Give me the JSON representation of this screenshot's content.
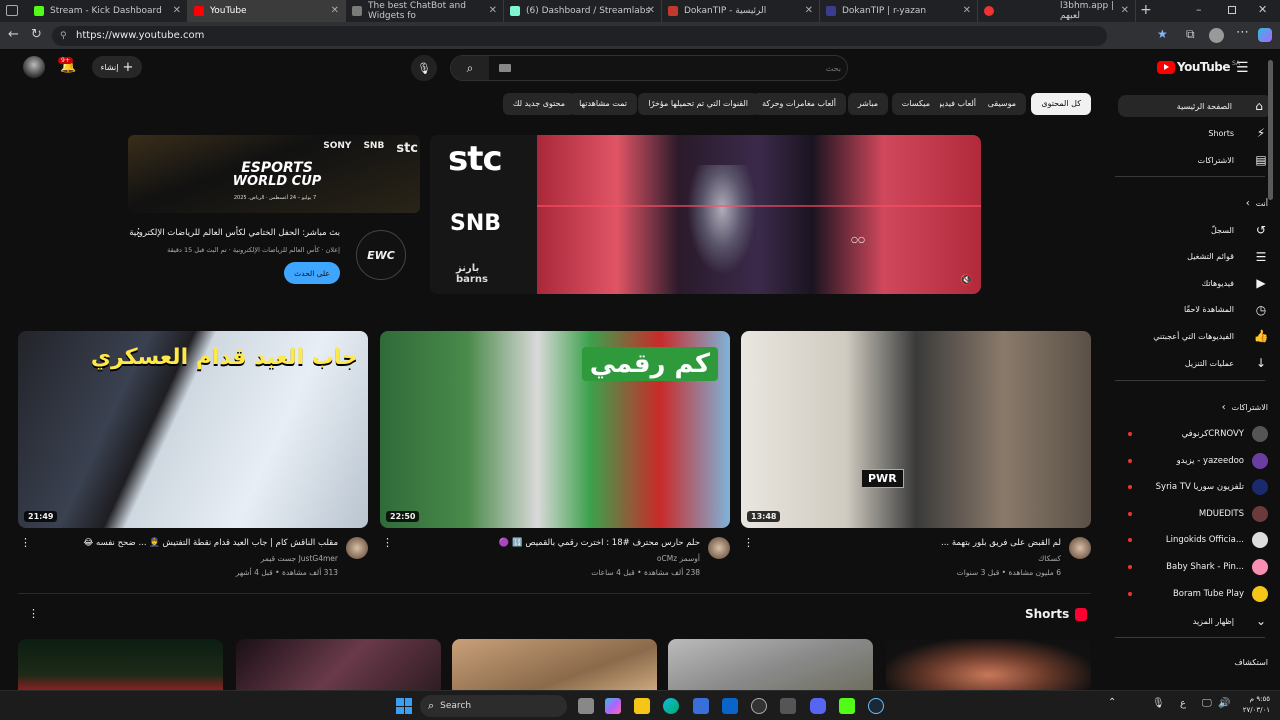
{
  "browser": {
    "tabs": [
      {
        "label": "Stream - Kick Dashboard",
        "color": "#53fc18"
      },
      {
        "label": "YouTube",
        "color": "#ff0000",
        "active": true
      },
      {
        "label": "The best ChatBot and Widgets fo",
        "color": "#7a7a7a"
      },
      {
        "label": "(6) Dashboard / Streamlabs",
        "color": "#80f5d2"
      },
      {
        "label": "DokanTIP - الرئيسية",
        "color": "#c0392b"
      },
      {
        "label": "DokanTIP | r-yazan",
        "color": "#3b3b8f"
      },
      {
        "label": "",
        "color": "#e33"
      },
      {
        "label": "l3bhm.app | لعبهم",
        "color": "#444"
      }
    ],
    "url": "https://www.youtube.com"
  },
  "youtube": {
    "logo_text": "YouTube",
    "logo_region": "SA",
    "search_placeholder": "بحث",
    "create_label": "إنشاء",
    "notif_count": "9+",
    "chips": [
      "كل المحتوى",
      "موسيقى",
      "ألعاب فيديو",
      "ميكسات",
      "مباشر",
      "ألعاب مغامرات وحركة",
      "القنوات التي تم تحميلها مؤخرًا",
      "تمت مشاهدتها",
      "محتوى جديد لك"
    ],
    "sidebar": {
      "primary": [
        {
          "label": "الصفحة الرئيسية",
          "icon": "home-icon",
          "glyph": "⌂"
        },
        {
          "label": "Shorts",
          "icon": "shorts-icon",
          "glyph": "⚡"
        },
        {
          "label": "الاشتراكات",
          "icon": "subscriptions-icon",
          "glyph": "▤"
        }
      ],
      "you_header": "أنت",
      "you_items": [
        {
          "label": "السجلّ",
          "icon": "history-icon",
          "glyph": "↺"
        },
        {
          "label": "قوائم التشغيل",
          "icon": "playlists-icon",
          "glyph": "☰"
        },
        {
          "label": "فيديوهاتك",
          "icon": "your-videos-icon",
          "glyph": "▶"
        },
        {
          "label": "المشاهدة لاحقًا",
          "icon": "watch-later-icon",
          "glyph": "◷"
        },
        {
          "label": "الفيديوهات التي أعجبتني",
          "icon": "like-icon",
          "glyph": "👍"
        },
        {
          "label": "عمليات التنزيل",
          "icon": "download-icon",
          "glyph": "↓"
        }
      ],
      "subs_header": "الاشتراكات",
      "subscriptions": [
        {
          "label": "كرنوفيCRNOVY",
          "color": "#555"
        },
        {
          "label": "يزيدو - yazeedoo",
          "color": "#6a3ea1"
        },
        {
          "label": "Syria TV تلفزيون سوريا",
          "color": "#1a2a6c"
        },
        {
          "label": "MDUEDITS",
          "color": "#6b3b3b"
        },
        {
          "label": "Lingokids Officia...",
          "color": "#ddd"
        },
        {
          "label": "Baby Shark - Pin...",
          "color": "#f78fb3"
        },
        {
          "label": "Boram Tube Play",
          "color": "#f5c518"
        }
      ],
      "show_more": "إظهار المزيد",
      "explore_header": "استكشاف"
    },
    "featured": {
      "banner_line1": "ESPORTS",
      "banner_line2": "WORLD CUP",
      "banner_sponsors": [
        "stc",
        "SNB",
        "SONY"
      ],
      "banner_dates": "7 يوليو – 24 أغسطس · الرياض، 2025",
      "title": "بث مباشر: الحفل الختامي لكأس العالم للرياضات الإلكترونية",
      "meta": "إعلان · كأس العالم للرياضات الإلكترونية · تم البث قبل 15 دقيقة",
      "cta": "على الحدث",
      "channel_logo": "EWC",
      "side_logos": [
        "stc",
        "SNB",
        "بارنز barns"
      ]
    },
    "videos": [
      {
        "title": "مقلب الناقش كام | جاب العيد قدام نقطة التفتيش 👮 ... ضحح نفسه 😂",
        "channel": "JustG4mer جست قيمر",
        "meta": "313 ألف مشاهدة • قبل 4 أشهر",
        "duration": "21:49",
        "overlay": "جاب العيد قدام العسكري"
      },
      {
        "title": "حلم حارس محترف #18 : اخترت رقمي بالقميص 🔢 🟣",
        "channel": "أوسمز oCMz",
        "meta": "238 ألف مشاهدة • قبل 4 ساعات",
        "duration": "22:50",
        "overlay": "كم رقمي"
      },
      {
        "title": "لم القبض على فريق بلور بتهمة ...",
        "channel": "كسكاك",
        "meta": "6 مليون مشاهدة • قبل 3 سنوات",
        "duration": "13:48",
        "overlay": "PWR"
      }
    ],
    "shorts_title": "Shorts"
  },
  "taskbar": {
    "search_label": "Search",
    "time": "٩:٥٥ م",
    "date": "٢٧/٠٣/٠١",
    "lang": "ع"
  }
}
